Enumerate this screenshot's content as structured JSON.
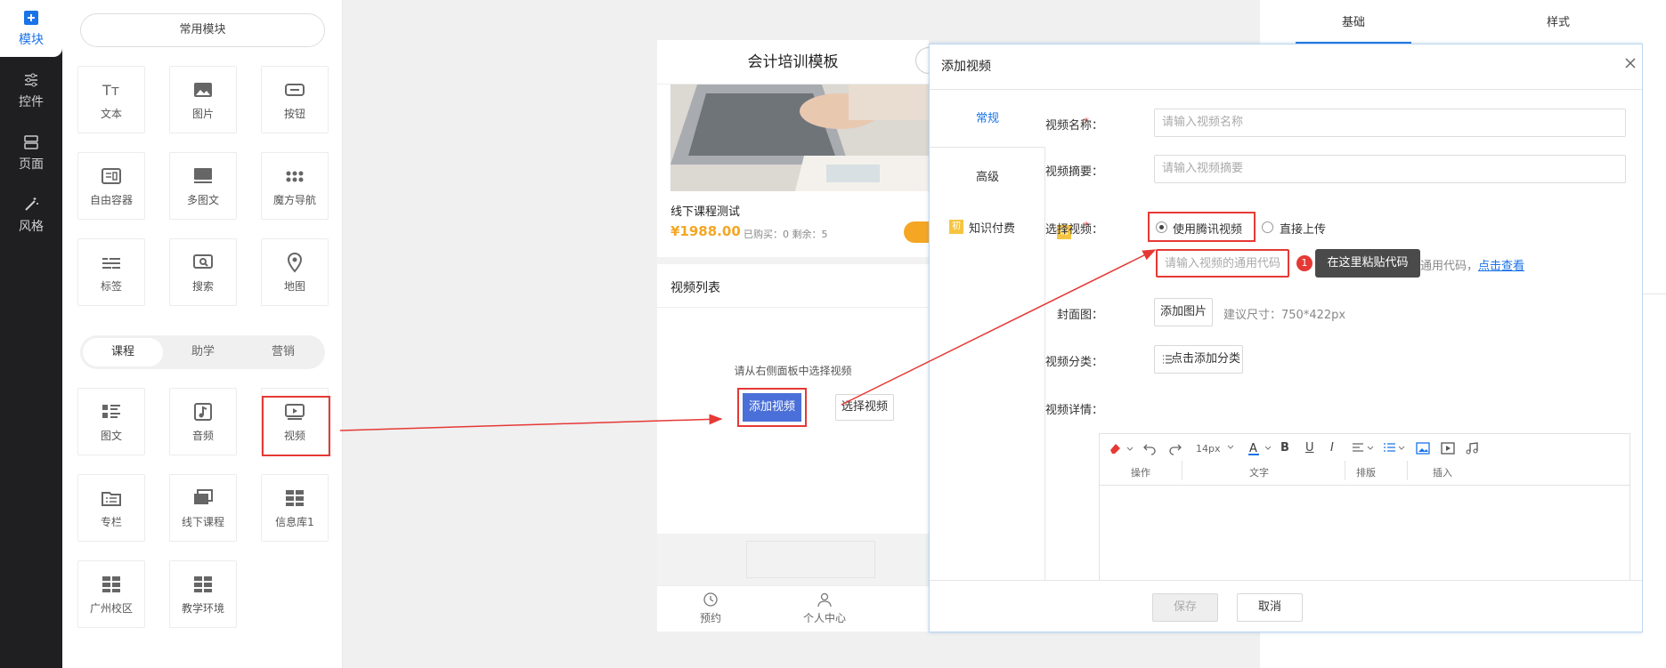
{
  "nav": {
    "items": [
      {
        "label": "模块"
      },
      {
        "label": "控件"
      },
      {
        "label": "页面"
      },
      {
        "label": "风格"
      }
    ]
  },
  "panel": {
    "common_title": "常用模块",
    "common": [
      "文本",
      "图片",
      "按钮",
      "自由容器",
      "多图文",
      "魔方导航",
      "标签",
      "搜索",
      "地图"
    ],
    "tabs": [
      "课程",
      "助学",
      "营销"
    ],
    "course": [
      "图文",
      "音频",
      "视频",
      "专栏",
      "线下课程",
      "信息库1",
      "广州校区",
      "教学环境"
    ]
  },
  "right_tabs": [
    "基础",
    "样式"
  ],
  "phone": {
    "title": "会计培训模板",
    "course_title": "线下课程测试",
    "price": "¥1988.00",
    "stats": "已购买：0  剩余：5",
    "section_title": "视频列表",
    "empty_hint": "请从右侧面板中选择视频",
    "add_button": "添加视频",
    "select_button": "选择视频",
    "tab1": "预约",
    "tab2": "个人中心"
  },
  "dialog": {
    "title": "添加视频",
    "side_tabs": [
      "常规",
      "高级",
      "知识付费"
    ],
    "name_label": "视频名称：",
    "name_placeholder": "请输入视频名称",
    "summary_label": "视频摘要：",
    "summary_placeholder": "请输入视频摘要",
    "select_label": "选择视频：",
    "radio_tencent": "使用腾讯视频",
    "radio_upload": "直接上传",
    "code_placeholder": "请输入视频的通用代码",
    "code_hint": "通用代码，",
    "code_link": "点击查看",
    "tooltip_num": "1",
    "tooltip_text": "在这里粘贴代码",
    "cover_label": "封面图：",
    "cover_button": "添加图片",
    "cover_hint": "建议尺寸：750*422px",
    "category_label": "视频分类：",
    "category_button": "点击添加分类",
    "detail_label": "视频详情：",
    "toolbar_groups": [
      "操作",
      "文字",
      "排版",
      "插入"
    ],
    "font_size": "14px",
    "save_button": "保存",
    "cancel_button": "取消",
    "paid_badge": "初"
  },
  "colors": {
    "accent": "#1a73e8",
    "red": "#e53935",
    "primary_btn": "#4a6fd8",
    "price": "#f5a623"
  }
}
